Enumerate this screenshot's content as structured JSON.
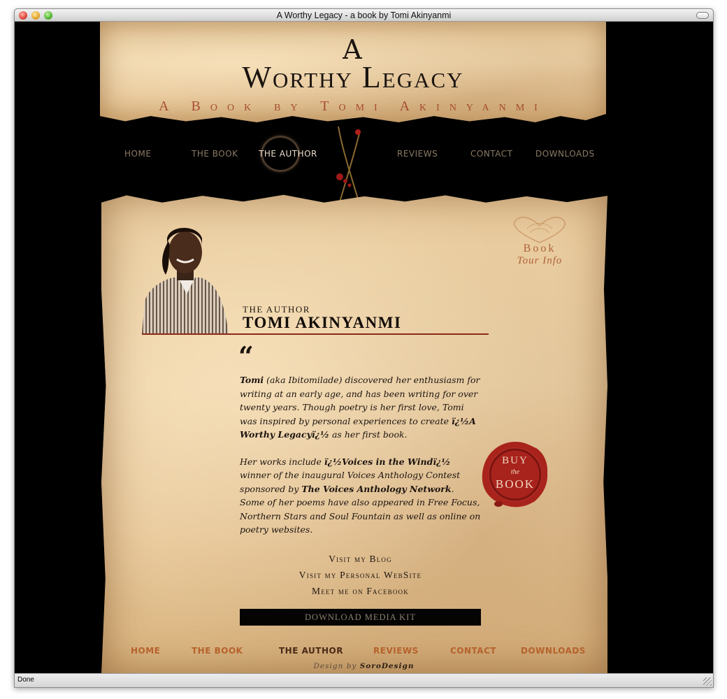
{
  "window": {
    "title": "A Worthy Legacy - a book by Tomi Akinyanmi",
    "status": "Done"
  },
  "header": {
    "title_a": "A",
    "title_main": "Worthy Legacy",
    "subtitle": "A Book by Tomi Akinyanmi"
  },
  "nav": {
    "items": [
      {
        "label": "HOME",
        "active": false
      },
      {
        "label": "THE BOOK",
        "active": false
      },
      {
        "label": "THE AUTHOR",
        "active": true
      },
      {
        "label": "REVIEWS",
        "active": false
      },
      {
        "label": "CONTACT",
        "active": false
      },
      {
        "label": "DOWNLOADS",
        "active": false
      }
    ]
  },
  "tour": {
    "book": "Book",
    "sub": "Tour Info"
  },
  "author": {
    "kicker": "THE AUTHOR",
    "name": "TOMI AKINYANMI"
  },
  "quote_mark": "“",
  "bio": {
    "p1_name": "Tomi",
    "p1_a": " (aka Ibitomilade) discovered her enthusiasm for writing at an early age, and has been writing for over twenty years. Though poetry is her first love, Tomi was inspired by personal experiences to create ",
    "p1_book": "ï¿½A Worthy Legacyï¿½",
    "p1_b": " as her first book.",
    "p2_a": "Her works include ",
    "p2_title": "ï¿½Voices in the Windï¿½",
    "p2_b": " winner of the inaugural Voices Anthology Contest sponsored by ",
    "p2_org": "The Voices Anthology Network",
    "p2_c": ". Some of her poems have also appeared in Free Focus, Northern Stars and Soul Fountain as well as online on poetry websites."
  },
  "buy": {
    "line1": "BUY",
    "line2": "the",
    "line3": "BOOK"
  },
  "links": [
    "Visit my Blog",
    "Visit my Personal WebSite",
    "Meet me on Facebook"
  ],
  "media_kit": "DOWNLOAD MEDIA KIT",
  "footer_nav": [
    {
      "label": "HOME",
      "active": false
    },
    {
      "label": "THE BOOK",
      "active": false
    },
    {
      "label": "THE AUTHOR",
      "active": true
    },
    {
      "label": "REVIEWS",
      "active": false
    },
    {
      "label": "CONTACT",
      "active": false
    },
    {
      "label": "DOWNLOADS",
      "active": false
    }
  ],
  "credit": {
    "prefix": "Design by ",
    "name": "SoroDesign"
  },
  "colors": {
    "parchment": "#e7c99b",
    "accent_red": "#9c3a22",
    "footer_link": "#b6622c",
    "seal": "#a8231c"
  }
}
